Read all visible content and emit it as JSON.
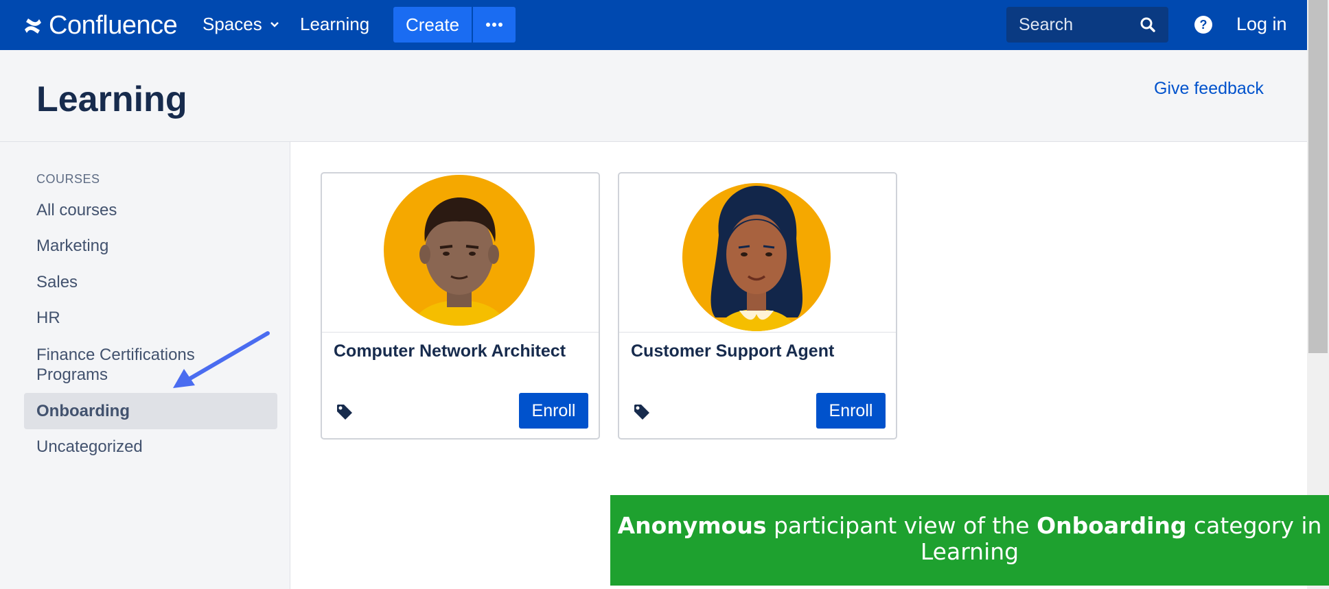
{
  "nav": {
    "logo_text": "Confluence",
    "spaces_label": "Spaces",
    "learning_label": "Learning",
    "create_label": "Create",
    "search_placeholder": "Search",
    "login_label": "Log in",
    "brand_color": "#0049b0"
  },
  "header": {
    "title": "Learning",
    "feedback_label": "Give feedback"
  },
  "sidebar": {
    "heading": "COURSES",
    "items": [
      {
        "label": "All courses"
      },
      {
        "label": "Marketing"
      },
      {
        "label": "Sales"
      },
      {
        "label": "HR"
      },
      {
        "label": "Finance Certifications Programs"
      },
      {
        "label": "Onboarding",
        "active": true
      },
      {
        "label": "Uncategorized"
      }
    ]
  },
  "courses": [
    {
      "title": "Computer Network Architect",
      "enroll_label": "Enroll",
      "avatar": "man-avatar"
    },
    {
      "title": "Customer Support Agent",
      "enroll_label": "Enroll",
      "avatar": "woman-avatar"
    }
  ],
  "caption": {
    "part1_bold": "Anonymous",
    "part2": " participant view of the ",
    "part3_bold": "Onboarding",
    "part4": " category in Learning",
    "color": "#1ea12f"
  }
}
